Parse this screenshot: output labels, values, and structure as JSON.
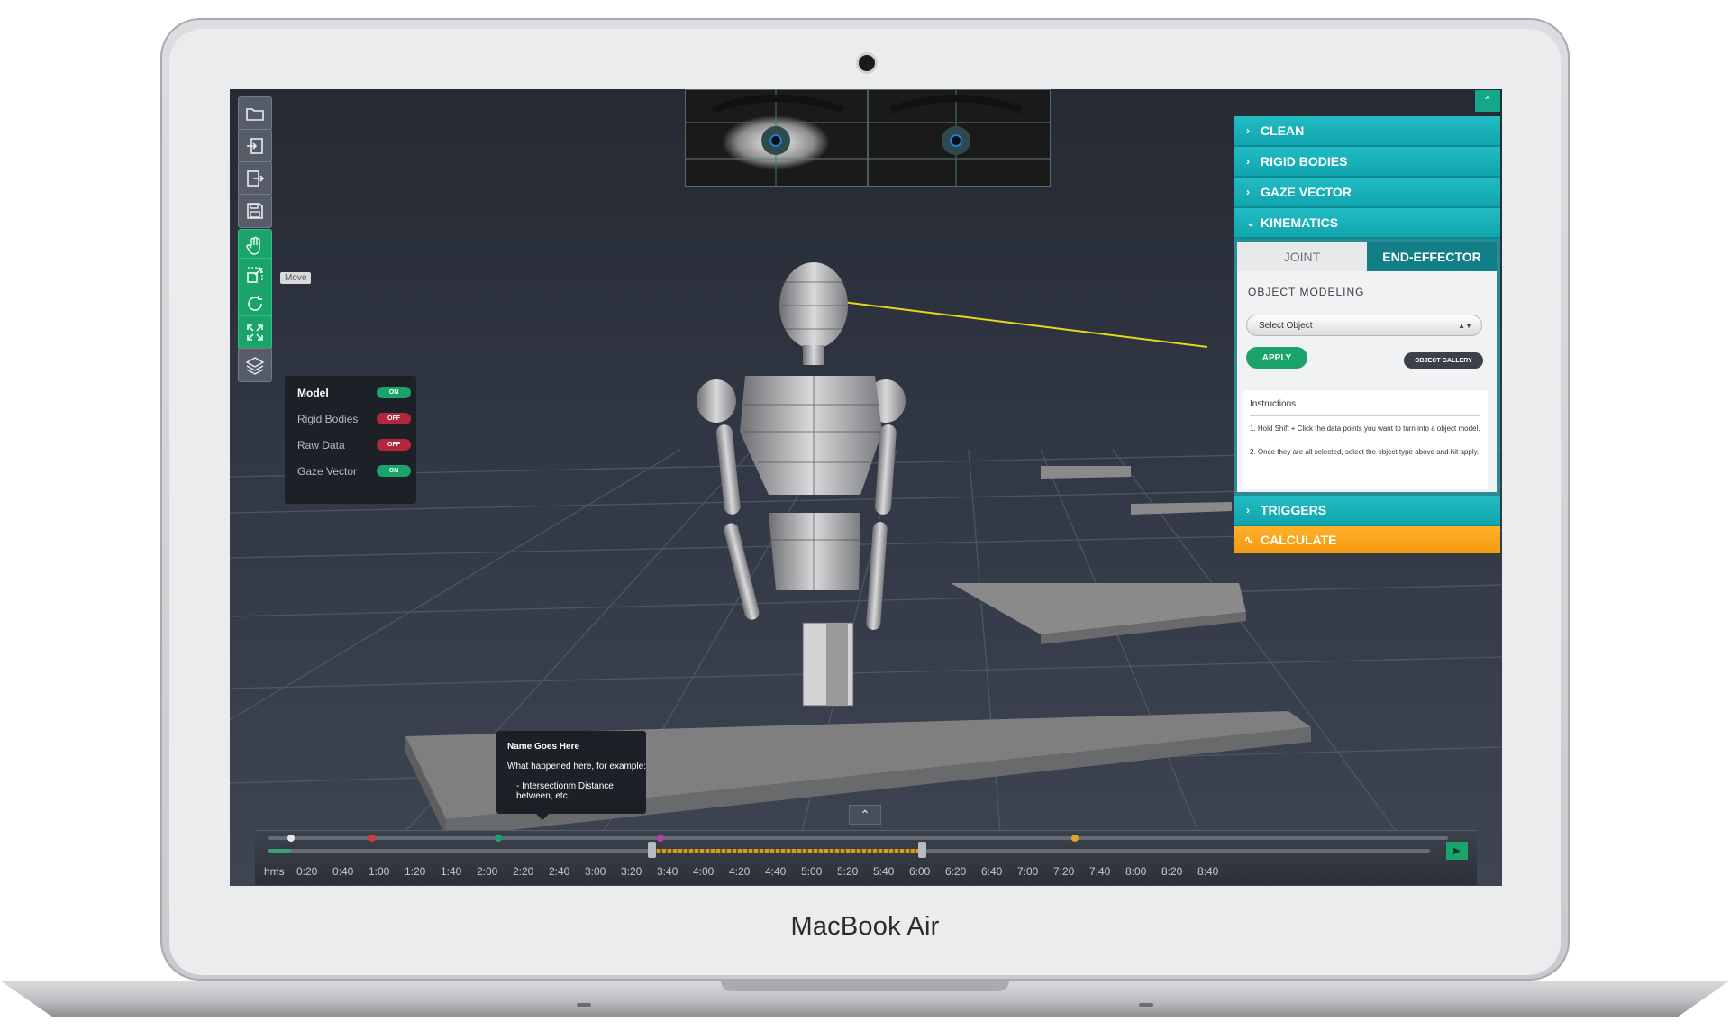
{
  "device": {
    "brand": "MacBook Air"
  },
  "toolbar": {
    "tools": [
      {
        "name": "open-folder",
        "icon": "folder-icon"
      },
      {
        "name": "import",
        "icon": "import-icon"
      },
      {
        "name": "export",
        "icon": "export-icon"
      },
      {
        "name": "save",
        "icon": "save-icon"
      },
      {
        "name": "move",
        "icon": "hand-icon"
      },
      {
        "name": "scale",
        "icon": "scale-icon"
      },
      {
        "name": "rotate",
        "icon": "rotate-icon"
      },
      {
        "name": "fit-view",
        "icon": "expand-icon"
      },
      {
        "name": "layers",
        "icon": "layers-icon"
      }
    ],
    "tooltip": "Move"
  },
  "layers": {
    "items": [
      {
        "label": "Model",
        "state": "ON",
        "active": true
      },
      {
        "label": "Rigid Bodies",
        "state": "OFF",
        "active": false
      },
      {
        "label": "Raw Data",
        "state": "OFF",
        "active": false
      },
      {
        "label": "Gaze Vector",
        "state": "ON",
        "active": false
      }
    ]
  },
  "panel": {
    "sections": {
      "clean": "CLEAN",
      "rigid_bodies": "RIGID BODIES",
      "gaze_vector": "GAZE VECTOR",
      "kinematics": "KINEMATICS",
      "triggers": "TRIGGERS",
      "calculate": "CALCULATE"
    },
    "tabs": {
      "joint": "JOINT",
      "end_effector": "END-EFFECTOR"
    },
    "object_modeling": "OBJECT MODELING",
    "select_placeholder": "Select Object",
    "apply_label": "APPLY",
    "gallery_label": "OBJECT GALLERY",
    "instructions": {
      "title": "Instructions",
      "step1": "1. Hold Shift + Click the data points you want to turn into a object model.",
      "step2": "2. Once they are all selected, select the object type above and hit apply."
    }
  },
  "event_tooltip": {
    "name": "Name Goes Here",
    "desc": "What happened here, for example:",
    "bullet": "- Intersectionm Distance between, etc."
  },
  "timeline": {
    "unit_label": "hms",
    "ticks": [
      "0:20",
      "0:40",
      "1:00",
      "1:20",
      "1:40",
      "2:00",
      "2:20",
      "2:40",
      "3:00",
      "3:20",
      "3:40",
      "4:00",
      "4:20",
      "4:40",
      "5:00",
      "5:20",
      "5:40",
      "6:00",
      "6:20",
      "6:40",
      "7:00",
      "7:20",
      "7:40",
      "8:00",
      "8:20",
      "8:40"
    ],
    "markers": [
      {
        "time": "0:10",
        "color": "#e9e9e9"
      },
      {
        "time": "0:55",
        "color": "#d73a3a"
      },
      {
        "time": "2:05",
        "color": "#1aa36b"
      },
      {
        "time": "3:35",
        "color": "#b23fb0"
      },
      {
        "time": "7:25",
        "color": "#e0a22a"
      }
    ],
    "playhead": "0:10",
    "selection_range": [
      "3:30",
      "6:00"
    ]
  },
  "colors": {
    "accent_teal": "#11a5ae",
    "accent_green": "#1aa36b",
    "accent_orange": "#f39a0f",
    "background": "#313744"
  }
}
